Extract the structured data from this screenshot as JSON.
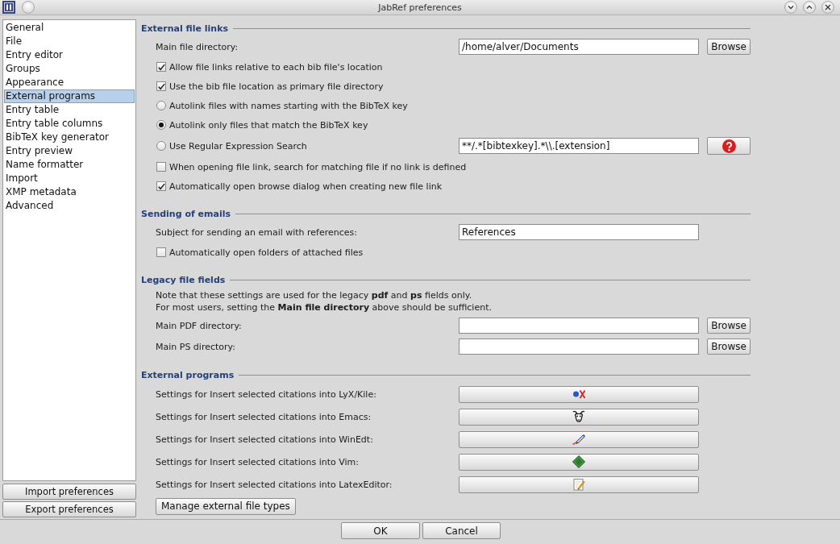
{
  "window": {
    "title": "JabRef preferences"
  },
  "sidebar": {
    "items": [
      {
        "label": "General",
        "selected": false
      },
      {
        "label": "File",
        "selected": false
      },
      {
        "label": "Entry editor",
        "selected": false
      },
      {
        "label": "Groups",
        "selected": false
      },
      {
        "label": "Appearance",
        "selected": false
      },
      {
        "label": "External programs",
        "selected": true
      },
      {
        "label": "Entry table",
        "selected": false
      },
      {
        "label": "Entry table columns",
        "selected": false
      },
      {
        "label": "BibTeX key generator",
        "selected": false
      },
      {
        "label": "Entry preview",
        "selected": false
      },
      {
        "label": "Name formatter",
        "selected": false
      },
      {
        "label": "Import",
        "selected": false
      },
      {
        "label": "XMP metadata",
        "selected": false
      },
      {
        "label": "Advanced",
        "selected": false
      }
    ],
    "buttons": [
      "Import preferences",
      "Export preferences"
    ]
  },
  "sections": [
    {
      "title": "External file links",
      "rows": [
        {
          "kind": "field",
          "label": "Main file directory:",
          "value": "/home/alver/Documents",
          "button": {
            "kind": "text",
            "label": "Browse"
          }
        },
        {
          "kind": "checkbox",
          "label": "Allow file links relative to each bib file's location",
          "checked": true
        },
        {
          "kind": "checkbox",
          "label": "Use the bib file location as primary file directory",
          "checked": true
        },
        {
          "kind": "radio",
          "label": "Autolink files with names starting with the BibTeX key",
          "selected": false
        },
        {
          "kind": "radio",
          "label": "Autolink only files that match the BibTeX key",
          "selected": true
        },
        {
          "kind": "radio",
          "label": "Use Regular Expression Search",
          "selected": false,
          "value": "**/.*[bibtexkey].*\\\\.[extension]",
          "button": {
            "kind": "help"
          }
        },
        {
          "kind": "checkbox",
          "label": "When opening file link, search for matching file if no link is defined",
          "checked": false
        },
        {
          "kind": "checkbox",
          "label": "Automatically open browse dialog when creating new file link",
          "checked": true
        }
      ]
    },
    {
      "title": "Sending of emails",
      "rows": [
        {
          "kind": "field",
          "label": "Subject for sending an email with references:",
          "value": "References"
        },
        {
          "kind": "checkbox",
          "label": "Automatically open folders of attached files",
          "checked": false
        }
      ]
    },
    {
      "title": "Legacy file fields",
      "rows": [
        {
          "kind": "note",
          "lines": [
            "Note that these settings are used for the legacy **pdf** and **ps** fields only.",
            "For most users, setting the **Main file directory** above should be sufficient."
          ]
        },
        {
          "kind": "field",
          "label": "Main PDF directory:",
          "button": {
            "kind": "text",
            "label": "Browse"
          }
        },
        {
          "kind": "field",
          "label": "Main PS directory:",
          "button": {
            "kind": "text",
            "label": "Browse"
          }
        }
      ]
    },
    {
      "title": "External programs",
      "rows": [
        {
          "kind": "program",
          "label": "Settings for Insert selected citations into LyX/Kile:"
        },
        {
          "kind": "program",
          "label": "Settings for Insert selected citations into Emacs:"
        },
        {
          "kind": "program",
          "label": "Settings for Insert selected citations into WinEdt:"
        },
        {
          "kind": "program",
          "label": "Settings for Insert selected citations into Vim:"
        },
        {
          "kind": "program",
          "label": "Settings for Insert selected citations into LatexEditor:"
        },
        {
          "kind": "button",
          "label": "Manage external file types"
        }
      ]
    }
  ],
  "footer": {
    "buttons": [
      "OK",
      "Cancel"
    ]
  }
}
